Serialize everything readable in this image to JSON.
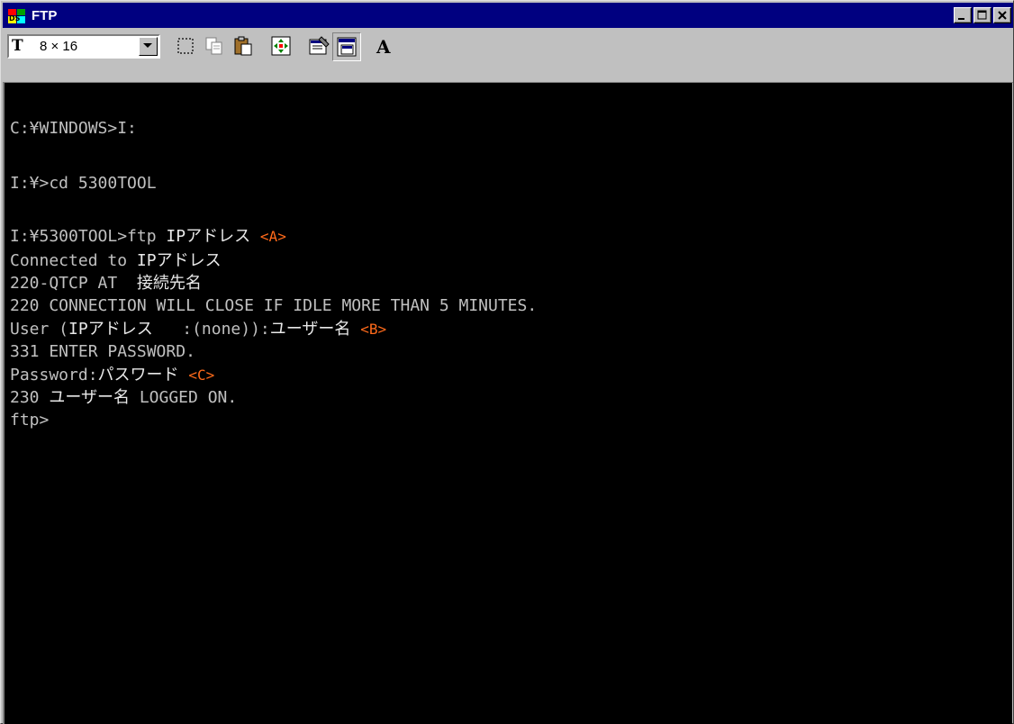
{
  "window": {
    "title": "FTP",
    "icon": "ms-dos-icon"
  },
  "toolbar": {
    "font_glyph": "T",
    "font_size": "8 × 16",
    "buttons": [
      "mark-icon",
      "copy-icon",
      "paste-icon",
      "fullscreen-icon",
      "properties-icon",
      "background-icon",
      "font-icon"
    ]
  },
  "terminal": {
    "lines": [
      {
        "text": "C:¥WINDOWS>I:"
      },
      {
        "text": "I:¥>cd 5300TOOL"
      },
      {
        "text": "I:¥5300TOOL>ftp ",
        "hl": "IPアドレス",
        "tag": "<A>"
      },
      {
        "text": "Connected to ",
        "hl": "IPアドレス"
      },
      {
        "text": "220-QTCP AT  ",
        "hl": "接続先名"
      },
      {
        "text": "220 CONNECTION WILL CLOSE IF IDLE MORE THAN 5 MINUTES."
      },
      {
        "pre": "User (",
        "hl": "IPアドレス",
        "post": "   :(none)):",
        "hl2": "ユーザー名",
        "tag": "<B>"
      },
      {
        "text": "331 ENTER PASSWORD."
      },
      {
        "text": "Password:",
        "hl": "パスワード",
        "tag": "<C>"
      },
      {
        "text": "230 ",
        "hl": "ユーザー名",
        "post": " LOGGED ON."
      },
      {
        "text": "ftp>"
      }
    ]
  }
}
